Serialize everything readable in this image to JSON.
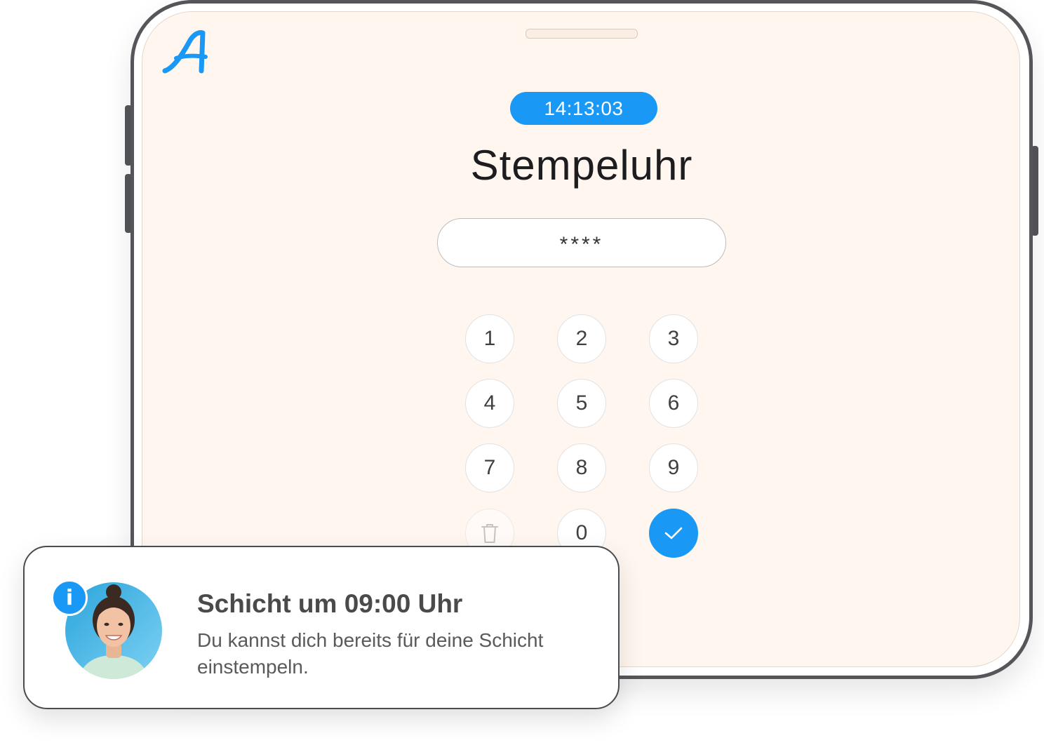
{
  "brand": {
    "logo_letter": "A",
    "accent_color": "#1a98f6"
  },
  "clock": {
    "time": "14:13:03"
  },
  "page": {
    "title": "Stempeluhr"
  },
  "pin": {
    "masked_value": "****"
  },
  "keypad": {
    "keys": [
      "1",
      "2",
      "3",
      "4",
      "5",
      "6",
      "7",
      "8",
      "9",
      "0"
    ],
    "delete_icon": "trash-icon",
    "confirm_icon": "check-icon"
  },
  "notification": {
    "badge_icon": "info-icon",
    "badge_glyph": "i",
    "title": "Schicht um 09:00 Uhr",
    "message": "Du kannst dich bereits für deine Schicht einstempeln."
  }
}
